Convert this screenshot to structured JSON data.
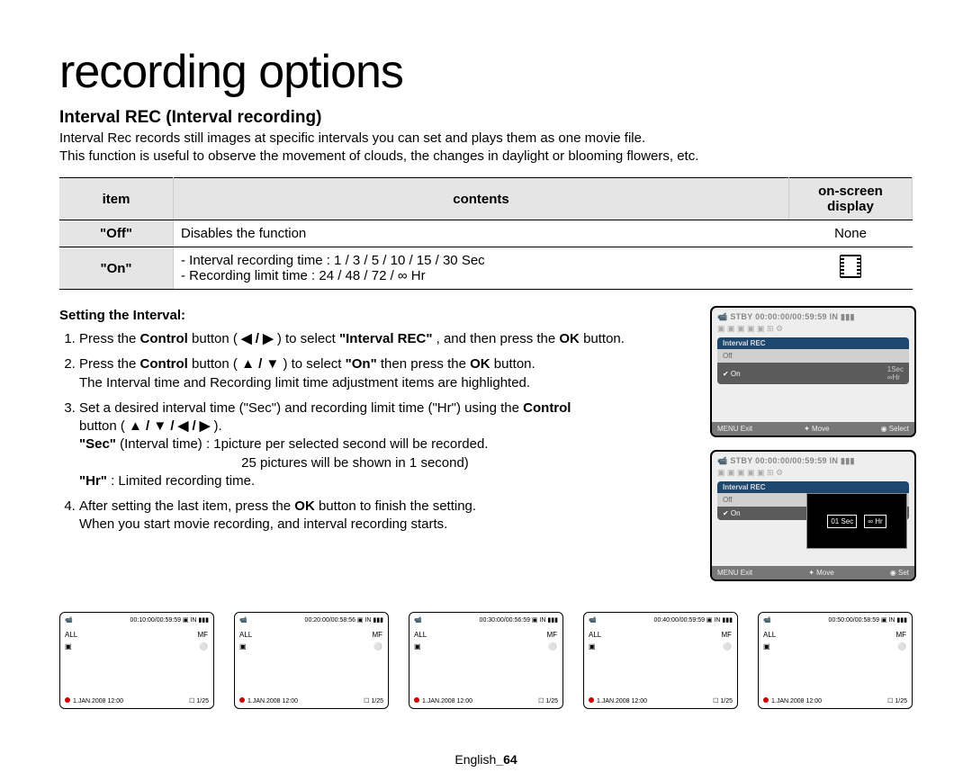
{
  "page": {
    "title": "recording options",
    "subtitle": "Interval REC (Interval recording)",
    "intro1": "Interval Rec records still images at specific intervals you can set and plays them as one movie file.",
    "intro2": "This function is useful to observe the movement of clouds, the changes in daylight or blooming flowers, etc.",
    "footer_lang": "English",
    "footer_page": "_64"
  },
  "table": {
    "headers": {
      "item": "item",
      "contents": "contents",
      "osd": "on-screen display"
    },
    "rows": [
      {
        "item": "\"Off\"",
        "contents": "Disables the function",
        "osd": "None"
      },
      {
        "item": "\"On\"",
        "contents_line1": "-  Interval recording time : 1 / 3 / 5 / 10 / 15 / 30 Sec",
        "contents_line2": "-  Recording limit time : 24 / 48 / 72 / ∞ Hr",
        "osd": "icon"
      }
    ]
  },
  "steps": {
    "heading": "Setting the Interval:",
    "s1a": "Press the ",
    "s1_control": "Control",
    "s1b": " button ( ",
    "s1_arrows": "◀ / ▶",
    "s1c": " ) to select ",
    "s1_target": "\"Interval REC\"",
    "s1d": ", and then press the ",
    "s1_ok": "OK",
    "s1e": " button.",
    "s2a": "Press the ",
    "s2_control": "Control",
    "s2b": " button ( ",
    "s2_arrows": "▲ / ▼",
    "s2c": " ) to select ",
    "s2_target": "\"On\"",
    "s2d": " then press the ",
    "s2_ok": "OK",
    "s2e": " button.",
    "s2f": "The Interval time and Recording limit time adjustment items are highlighted.",
    "s3a": "Set a desired interval time (\"Sec\") and recording limit time (\"Hr\") using the ",
    "s3_control": "Control",
    "s3b": " button ( ",
    "s3_arrows": "▲ / ▼ / ◀ / ▶",
    "s3c": " ).",
    "s3_sec_label": "\"Sec\"",
    "s3_sec_desc": " (Interval time)  :  1picture per selected second will be recorded.",
    "s3_sec_desc2": "25 pictures will be shown in 1 second)",
    "s3_hr_label": "\"Hr\"",
    "s3_hr_desc": " : Limited recording time.",
    "s4a": "After setting the last item, press the ",
    "s4_ok": "OK",
    "s4b": " button to finish the setting.",
    "s4c": "When you start movie recording, and interval recording starts."
  },
  "lcd": {
    "top_status": "STBY 00:00:00/00:59:59  IN ▮▮▮",
    "iconrow": "▣ ▣ ▣ ▣ ▣ ⊞ ⚙",
    "menu_title": "Interval REC",
    "off": "Off",
    "on": "On",
    "on_dot": "✔ On",
    "right1": "1Sec",
    "right2": "∞Hr",
    "bottom_menu": "MENU Exit",
    "bottom_move": "✦ Move",
    "bottom_select": "◉ Select",
    "bottom_set": "◉ Set",
    "editbox_sec": "01 Sec",
    "editbox_hr": "∞ Hr"
  },
  "thumbs": [
    {
      "tc": "00:10:00/00:59:59",
      "date": "1.JAN.2008 12:00",
      "count": "1/25"
    },
    {
      "tc": "00:20:00/00:58:56",
      "date": "1.JAN.2008 12:00",
      "count": "1/25"
    },
    {
      "tc": "00:30:00/00:56:59",
      "date": "1.JAN.2008 12:00",
      "count": "1/25"
    },
    {
      "tc": "00:40:00/00:59:59",
      "date": "1.JAN.2008 12:00",
      "count": "1/25"
    },
    {
      "tc": "00:50:00/00:58:59",
      "date": "1.JAN.2008 12:00",
      "count": "1/25"
    }
  ],
  "thumb_common": {
    "top_right": "IN ▮▮▮",
    "left_icons": "ALL",
    "right_icons": "MF",
    "bot_right_prefix": "☐ "
  }
}
